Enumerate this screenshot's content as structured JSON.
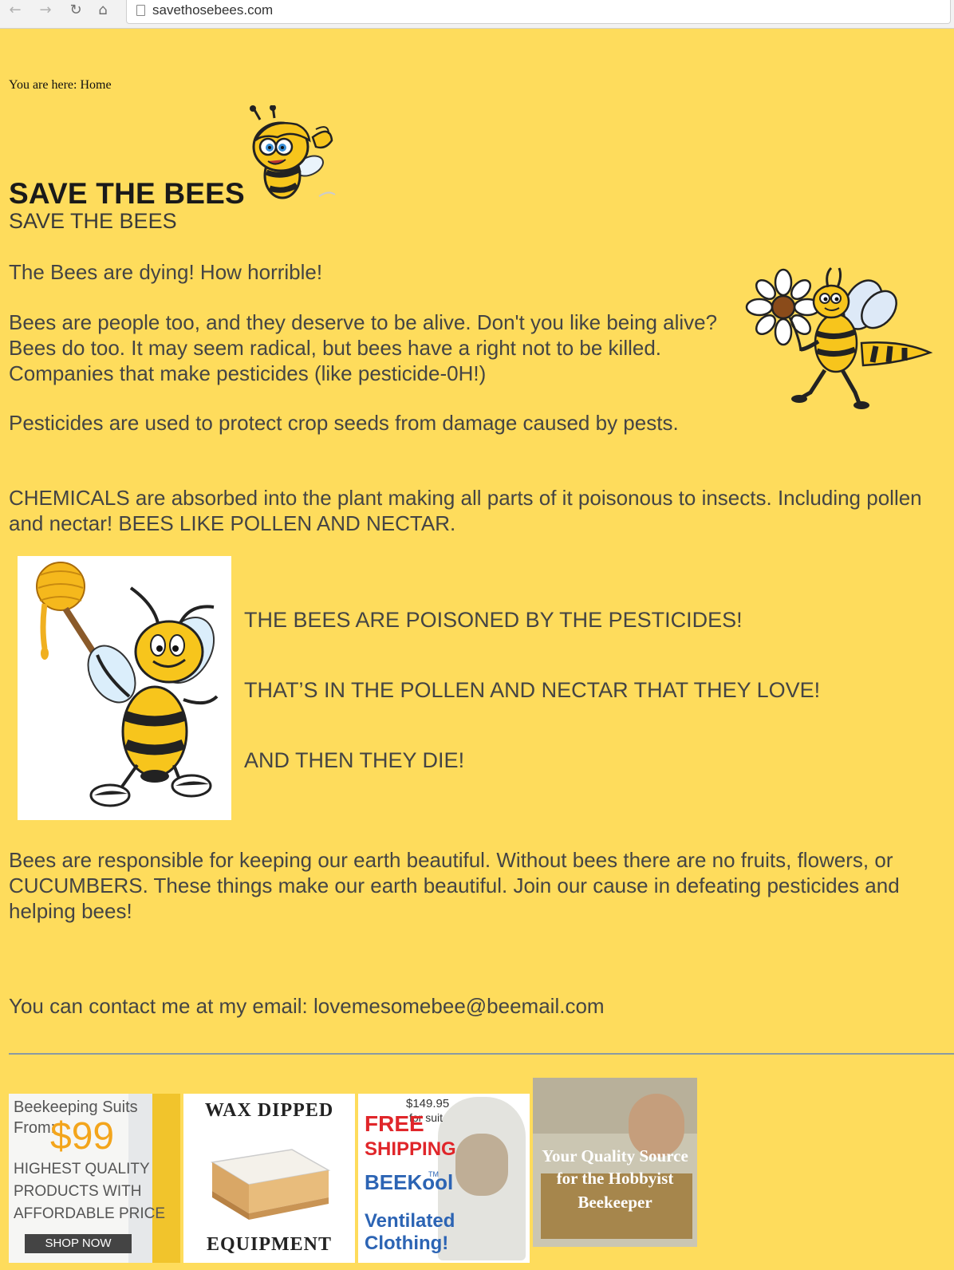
{
  "browser": {
    "url": "savethosebees.com",
    "back_icon": "arrow-left-icon",
    "forward_icon": "arrow-right-icon",
    "reload_icon": "reload-icon",
    "home_icon": "home-icon"
  },
  "page": {
    "breadcrumb": "You are here: Home",
    "title": "SAVE THE BEES",
    "subtitle": "SAVE THE BEES",
    "paragraphs": [
      "The Bees are dying! How horrible!",
      "Bees are people too, and they deserve to be alive. Don't you like being alive? Bees do too. It may seem radical, but bees have a right not to be killed. Companies that make pesticides (like pesticide-0H!)",
      "Pesticides are used to protect crop seeds from damage caused by pests.",
      "CHEMICALS are absorbed into the plant making all parts of it poisonous to insects. Including pollen and nectar! BEES LIKE POLLEN AND NECTAR."
    ],
    "callouts": [
      "THE BEES ARE POISONED BY THE PESTICIDES!",
      "THAT’S IN THE POLLEN AND NECTAR THAT THEY LOVE!",
      "AND THEN THEY DIE!"
    ],
    "closing": "Bees are responsible for keeping our earth beautiful. Without bees there are no fruits, flowers, or CUCUMBERS. These things make our earth beautiful. Join our cause in defeating pesticides and helping bees!",
    "contact": "You can contact me at my email: lovemesomebee@beemail.com",
    "colors": {
      "background": "#fedc5c",
      "text": "#444444",
      "bee_yellow": "#f7c51c"
    }
  },
  "ads": [
    {
      "line1": "Beekeeping Suits",
      "line2": "From:",
      "price": "$99",
      "tagline1": "HIGHEST QUALITY",
      "tagline2": "PRODUCTS WITH",
      "tagline3": "AFFORDABLE PRICE",
      "cta": "SHOP NOW"
    },
    {
      "top": "WAX DIPPED",
      "bottom": "EQUIPMENT"
    },
    {
      "price": "$149.95",
      "price_note": "for suit",
      "free": "FREE",
      "shipping": "SHIPPING",
      "brand": "BEEKool",
      "tm": "TM",
      "tagline": "Ventilated Clothing!"
    },
    {
      "line1": "Your Quality Source",
      "line2": "for the Hobbyist",
      "line3": "Beekeeper"
    }
  ]
}
